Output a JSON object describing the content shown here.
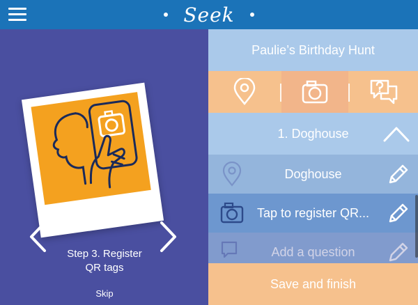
{
  "app": {
    "brand": "Seek"
  },
  "onboarding": {
    "step_text_line1": "Step 3. Register",
    "step_text_line2": "QR tags",
    "skip_label": "Skip",
    "accent": "#f4a11f",
    "background": "#4a4fa0"
  },
  "hunt": {
    "title": "Paulie’s Birthday Hunt",
    "toolbar_icons": [
      "location-pin-icon",
      "camera-icon",
      "question-chat-icon"
    ],
    "active_toolbar_icon": "camera-icon",
    "step_label": "1. Doghouse",
    "location_label": "Doghouse",
    "qr_label": "Tap to register QR...",
    "question_label": "Add a question",
    "save_label": "Save and finish"
  },
  "colors": {
    "header": "#1b73b8",
    "light_blue": "#aac9ea",
    "mid_blue": "#94b5dc",
    "active_blue": "#6d97cf",
    "orange": "#f6c18d"
  }
}
